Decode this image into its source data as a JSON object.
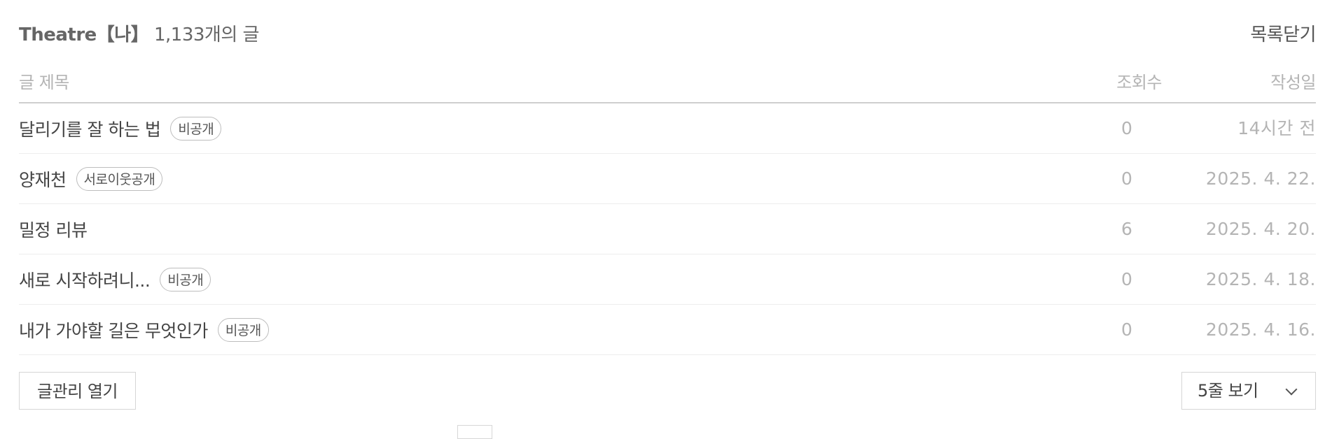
{
  "header": {
    "category_name": "Theatre【나】",
    "post_count": "1,133개의 글",
    "close_list_label": "목록닫기"
  },
  "table": {
    "columns": {
      "title": "글 제목",
      "views": "조회수",
      "date": "작성일"
    },
    "rows": [
      {
        "title": "달리기를 잘 하는 법",
        "badge": "비공개",
        "views": "0",
        "date": "14시간 전"
      },
      {
        "title": "양재천",
        "badge": "서로이웃공개",
        "views": "0",
        "date": "2025. 4. 22."
      },
      {
        "title": "밀정 리뷰",
        "badge": "",
        "views": "6",
        "date": "2025. 4. 20."
      },
      {
        "title": "새로 시작하려니...",
        "badge": "비공개",
        "views": "0",
        "date": "2025. 4. 18."
      },
      {
        "title": "내가 가야할 길은 무엇인가",
        "badge": "비공개",
        "views": "0",
        "date": "2025. 4. 16."
      }
    ]
  },
  "footer": {
    "manage_button_label": "글관리 열기",
    "rows_select_label": "5줄 보기",
    "rows_select_icon": "chevron-down-icon"
  }
}
